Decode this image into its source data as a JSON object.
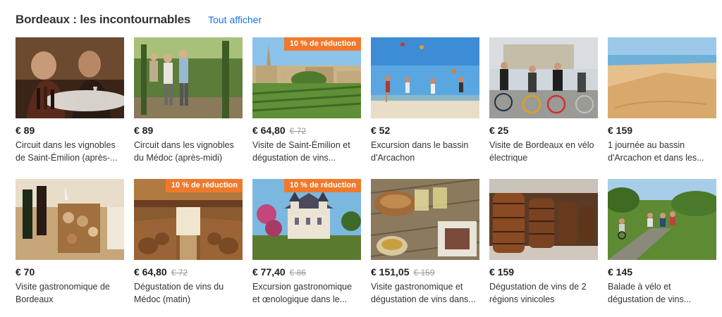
{
  "header": {
    "title": "Bordeaux : les incontournables",
    "show_all": "Tout afficher"
  },
  "colors": {
    "link": "#1a73e8",
    "badge": "#ef7a2c"
  },
  "rows": [
    [
      {
        "price": "€ 89",
        "old_price": "",
        "badge": "",
        "name": "Circuit dans les vignobles de Saint-Émilion (après-..."
      },
      {
        "price": "€ 89",
        "old_price": "",
        "badge": "",
        "name": "Circuit dans les vignobles du Médoc (après-midi)"
      },
      {
        "price": "€ 64,80",
        "old_price": "€ 72",
        "badge": "10 % de réduction",
        "name": "Visite de Saint-Émilion et dégustation de vins..."
      },
      {
        "price": "€ 52",
        "old_price": "",
        "badge": "",
        "name": "Excursion dans le bassin d'Arcachon"
      },
      {
        "price": "€ 25",
        "old_price": "",
        "badge": "",
        "name": "Visite de Bordeaux en vélo électrique"
      },
      {
        "price": "€ 159",
        "old_price": "",
        "badge": "",
        "name": "1 journée au bassin d'Arcachon et dans les..."
      }
    ],
    [
      {
        "price": "€ 70",
        "old_price": "",
        "badge": "",
        "name": "Visite gastronomique de Bordeaux"
      },
      {
        "price": "€ 64,80",
        "old_price": "€ 72",
        "badge": "10 % de réduction",
        "name": "Dégustation de vins du Médoc (matin)"
      },
      {
        "price": "€ 77,40",
        "old_price": "€ 86",
        "badge": "10 % de réduction",
        "name": "Excursion gastronomique et œnologique dans le..."
      },
      {
        "price": "€ 151,05",
        "old_price": "€ 159",
        "badge": "",
        "name": "Visite gastronomique et dégustation de vins dans..."
      },
      {
        "price": "€ 159",
        "old_price": "",
        "badge": "",
        "name": "Dégustation de vins de 2 régions vinicoles"
      },
      {
        "price": "€ 145",
        "old_price": "",
        "badge": "",
        "name": "Balade à vélo et dégustation de vins..."
      }
    ]
  ]
}
